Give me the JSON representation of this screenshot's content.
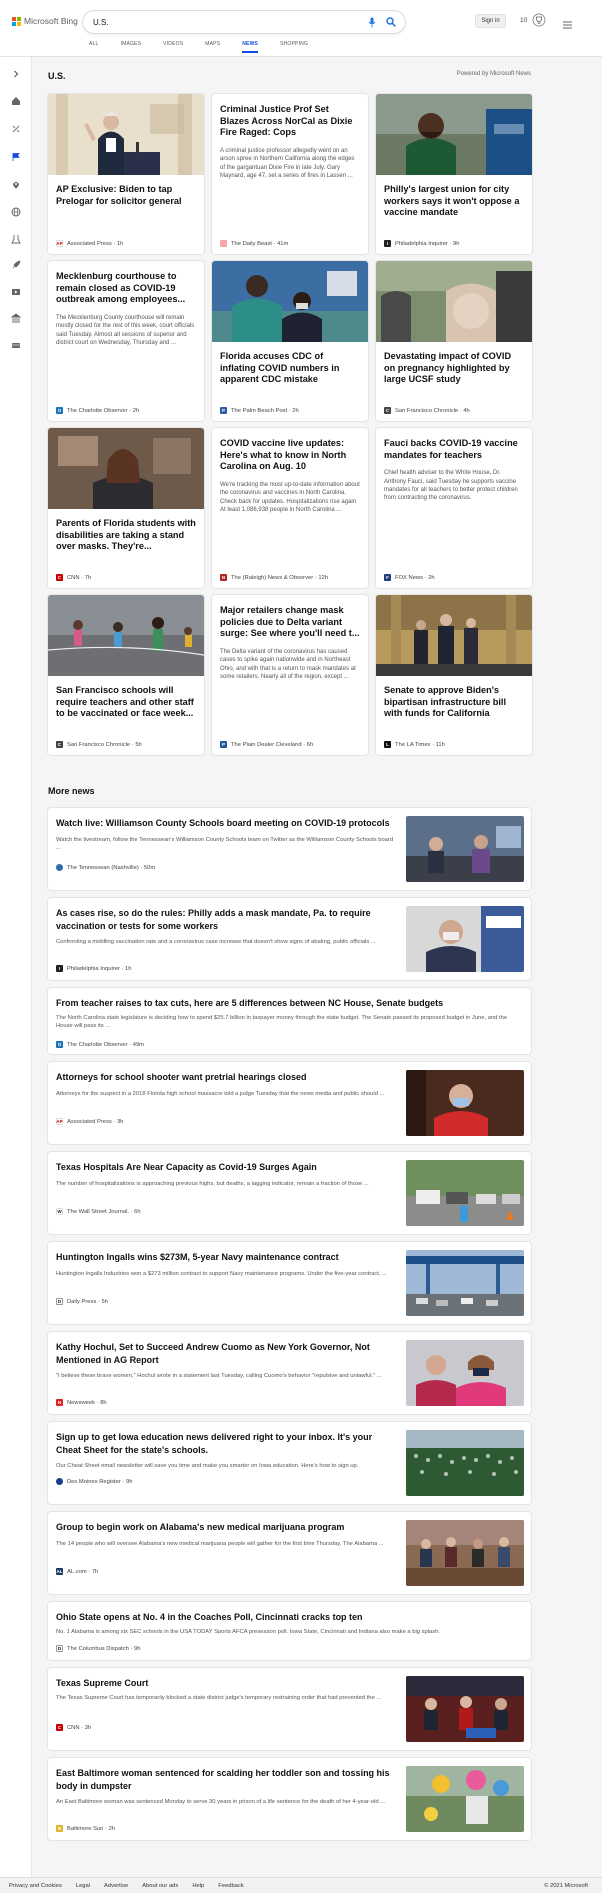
{
  "header": {
    "logo_text": "Microsoft Bing",
    "search_value": "U.S.",
    "signin_label": "Sign in",
    "rewards_count": "10",
    "tabs": [
      "ALL",
      "IMAGES",
      "VIDEOS",
      "MAPS",
      "NEWS",
      "SHOPPING"
    ],
    "active_tab": "NEWS",
    "accent": "#174ae4"
  },
  "sidebar": {
    "icons": [
      "chevron-right-icon",
      "home-icon",
      "discover-icon",
      "flag-icon",
      "location-pin-icon",
      "globe-icon",
      "science-icon",
      "rocket-icon",
      "entertainment-icon",
      "money-icon",
      "trophy-icon",
      "car-icon"
    ]
  },
  "section": {
    "title": "U.S.",
    "powered_by": "Powered by Microsoft News"
  },
  "cards": [
    {
      "title": "AP Exclusive: Biden to tap Prelogar for solicitor general",
      "snippet": "",
      "source": "Associated Press",
      "time": "1h",
      "has_image": true
    },
    {
      "title": "Criminal Justice Prof Set Blazes Across NorCal as Dixie Fire Raged: Cops",
      "snippet": "A criminal justice professor allegedly went on an arson spree in Northern California along the edges of the gargantuan Dixie Fire in late July. Gary Maynard, age 47, set a series of fires in Lassen ...",
      "source": "The Daily Beast",
      "time": "41m",
      "has_image": false
    },
    {
      "title": "Philly's largest union for city workers says it won't oppose a vaccine mandate",
      "snippet": "",
      "source": "Philadelphia Inquirer",
      "time": "9h",
      "has_image": true
    },
    {
      "title": "Mecklenburg courthouse to remain closed as COVID-19 outbreak among employees...",
      "snippet": "The Mecklenburg County courthouse will remain mostly closed for the rest of this week, court officials said Tuesday. Almost all sessions of superior and district court on Wednesday, Thursday and ...",
      "source": "The Charlotte Observer",
      "time": "2h",
      "has_image": false
    },
    {
      "title": "Florida accuses CDC of inflating COVID numbers in apparent CDC mistake",
      "snippet": "",
      "source": "The Palm Beach Post",
      "time": "2h",
      "has_image": true
    },
    {
      "title": "Devastating impact of COVID on pregnancy highlighted by large UCSF study",
      "snippet": "",
      "source": "San Francisco Chronicle",
      "time": "4h",
      "has_image": true
    },
    {
      "title": "Parents of Florida students with disabilities are taking a stand over masks. They're...",
      "snippet": "",
      "source": "CNN",
      "time": "7h",
      "has_image": true
    },
    {
      "title": "COVID vaccine live updates: Here's what to know in North Carolina on Aug. 10",
      "snippet": "We're tracking the most up-to-date information about the coronavirus and vaccines in North Carolina. Check back for updates. Hospitalizations rise again At least 1,086,938 people in North Carolina ...",
      "source": "The (Raleigh) News & Observer",
      "time": "12h",
      "has_image": false
    },
    {
      "title": "Fauci backs COVID-19 vaccine mandates for teachers",
      "snippet": "Chief health adviser to the White House, Dr. Anthony Fauci, said Tuesday he supports vaccine mandates for all teachers to better protect children from contracting the coronavirus.",
      "source": "FOX News",
      "time": "2h",
      "has_image": false
    },
    {
      "title": "San Francisco schools will require teachers and other staff to be vaccinated or face week...",
      "snippet": "",
      "source": "San Francisco Chronicle",
      "time": "5h",
      "has_image": true
    },
    {
      "title": "Major retailers change mask policies due to Delta variant surge: See where you'll need t...",
      "snippet": "The Delta variant of the coronavirus has caused cases to spike again nationwide and in Northeast Ohio, and with that is a return to mask mandates at some retailers. Nearly all of the region, except ...",
      "source": "The Plain Dealer Cleveland",
      "time": "6h",
      "has_image": false
    },
    {
      "title": "Senate to approve Biden's bipartisan infrastructure bill with funds for California",
      "snippet": "",
      "source": "The LA Times",
      "time": "11h",
      "has_image": true
    }
  ],
  "more_news_title": "More news",
  "more_news": [
    {
      "title": "Watch live: Williamson County Schools board meeting on COVID-19 protocols",
      "snippet": "Watch the livestream, follow the Tennessean's Williamson County Schools team on Twitter as the Williamson County Schools board ...",
      "source": "The Tennessean (Nashville)",
      "time": "50m",
      "has_image": true
    },
    {
      "title": "As cases rise, so do the rules: Philly adds a mask mandate, Pa. to require vaccination or tests for some workers",
      "snippet": "Confronting a middling vaccination rate and a coronavirus case increase that doesn't show signs of abating, public officials ...",
      "source": "Philadelphia Inquirer",
      "time": "1h",
      "has_image": true
    },
    {
      "title": "From teacher raises to tax cuts, here are 5 differences between NC House, Senate budgets",
      "snippet": "The North Carolina state legislature is deciding how to spend $25.7 billion in taxpayer money through the state budget. The Senate passed its proposed budget in June, and the House will pass its ...",
      "source": "The Charlotte Observer",
      "time": "49m",
      "has_image": false
    },
    {
      "title": "Attorneys for school shooter want pretrial hearings closed",
      "snippet": "Attorneys for the suspect in a 2018 Florida high school massacre told a judge Tuesday that the news media and public should ...",
      "source": "Associated Press",
      "time": "3h",
      "has_image": true
    },
    {
      "title": "Texas Hospitals Are Near Capacity as Covid-19 Surges Again",
      "snippet": "The number of hospitalizations is approaching previous highs, but deaths, a lagging indicator, remain a fraction of those ...",
      "source": "The Wall Street Journal.",
      "time": "6h",
      "has_image": true
    },
    {
      "title": "Huntington Ingalls wins $273M, 5-year Navy maintenance contract",
      "snippet": "Huntington Ingalls Industries won a $273 million contract to support Navy maintenance programs. Under the five-year contract, ...",
      "source": "Daily Press",
      "time": "5h",
      "has_image": true
    },
    {
      "title": "Kathy Hochul, Set to Succeed Andrew Cuomo as New York Governor, Not Mentioned in AG Report",
      "snippet": "\"I believe these brave women,\" Hochul wrote in a statement last Tuesday, calling Cuomo's behavior \"repulsive and unlawful.\" ...",
      "source": "Newsweek",
      "time": "8h",
      "has_image": true
    },
    {
      "title": "Sign up to get Iowa education news delivered right to your inbox. It's your Cheat Sheet for the state's schools.",
      "snippet": "Our Cheat Sheet email newsletter will save you time and make you smarter on Iowa education. Here's how to sign up.",
      "source": "Des Moines Register",
      "time": "9h",
      "has_image": true
    },
    {
      "title": "Group to begin work on Alabama's new medical marijuana program",
      "snippet": "The 14 people who will oversee Alabama's new medical marijuana people will gather for the first time Thursday. The Alabama ...",
      "source": "AL.com",
      "time": "7h",
      "has_image": true
    },
    {
      "title": "Ohio State opens at No. 4 in the Coaches Poll, Cincinnati cracks top ten",
      "snippet": "No. 1 Alabama is among six SEC schools in the USA TODAY Sports AFCA preseason poll. Iowa State, Cincinnati and Indiana also make a big splash.",
      "source": "The Columbus Dispatch",
      "time": "9h",
      "has_image": false
    },
    {
      "title": "Texas Supreme Court",
      "snippet": "The Texas Supreme Court has temporarily blocked a state district judge's temporary restraining order that had prevented the ...",
      "source": "CNN",
      "time": "3h",
      "has_image": true
    },
    {
      "title": "East Baltimore woman sentenced for scalding her toddler son and tossing his body in dumpster",
      "snippet": "An East Baltimore woman was sentenced Monday to serve 30 years in prison of a life sentence for the death of her 4-year-old ...",
      "source": "Baltimore Sun",
      "time": "2h",
      "has_image": true
    }
  ],
  "footer": {
    "links": [
      "Privacy and Cookies",
      "Legal",
      "Advertise",
      "About our ads",
      "Help",
      "Feedback"
    ],
    "copyright": "© 2021 Microsoft"
  }
}
